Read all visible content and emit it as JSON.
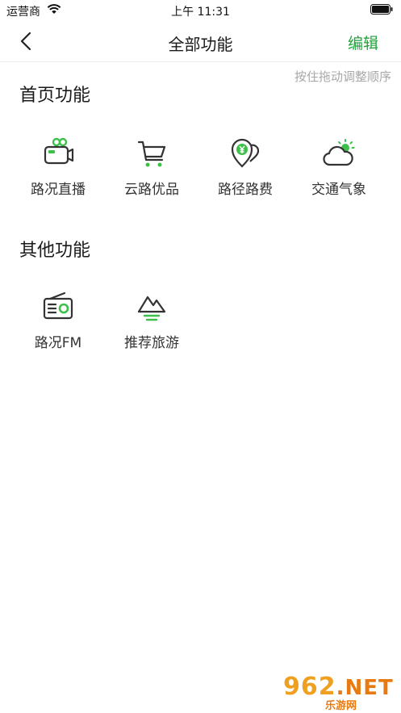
{
  "status_bar": {
    "carrier": "运营商",
    "time": "上午 11:31"
  },
  "nav": {
    "title": "全部功能",
    "edit_label": "编辑"
  },
  "hint": "按住拖动调整顺序",
  "sections": [
    {
      "title": "首页功能",
      "items": [
        {
          "label": "路况直播",
          "icon": "camera-icon"
        },
        {
          "label": "云路优品",
          "icon": "cart-icon"
        },
        {
          "label": "路径路费",
          "icon": "toll-icon"
        },
        {
          "label": "交通气象",
          "icon": "weather-icon"
        }
      ]
    },
    {
      "title": "其他功能",
      "items": [
        {
          "label": "路况FM",
          "icon": "radio-icon"
        },
        {
          "label": "推荐旅游",
          "icon": "mountain-icon"
        }
      ]
    }
  ],
  "watermark": {
    "logo_digits": "962",
    "logo_suffix": ".NET",
    "sub": "乐游网"
  },
  "colors": {
    "accent": "#1fa33a",
    "icon_green": "#3cc04a",
    "icon_dark": "#333333",
    "hint": "#a8a8a8"
  }
}
